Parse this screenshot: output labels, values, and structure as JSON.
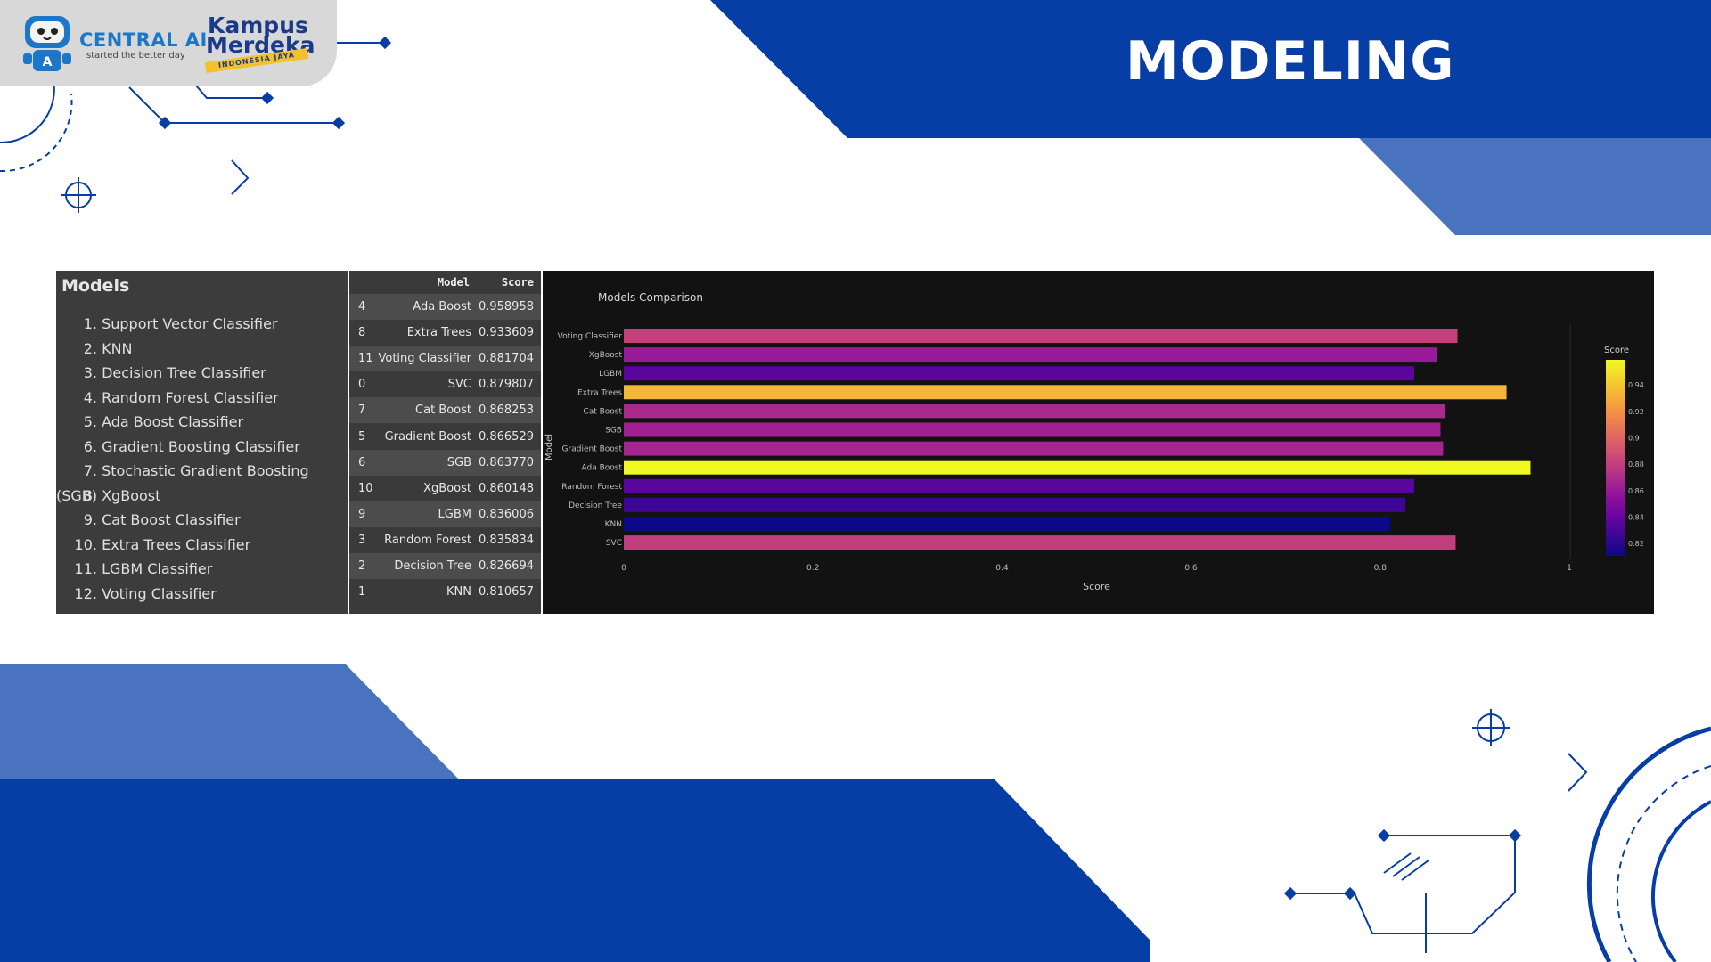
{
  "header": {
    "brand_name": "CENTRAL AI",
    "brand_tagline": "started the better day",
    "partner_line1": "Kampus",
    "partner_line2": "Merdeka",
    "partner_ribbon": "INDONESIA JAYA",
    "title": "MODELING"
  },
  "colors": {
    "primary_blue": "#073ea6",
    "light_blue": "#4a73bf",
    "panel_dark": "#121212"
  },
  "models_panel": {
    "title": "Models",
    "items": [
      {
        "num": "1.",
        "label": "Support Vector Classifier"
      },
      {
        "num": "2.",
        "label": "KNN"
      },
      {
        "num": "3.",
        "label": "Decision Tree Classifier"
      },
      {
        "num": "4.",
        "label": "Random Forest Classifier"
      },
      {
        "num": "5.",
        "label": "Ada Boost Classifier"
      },
      {
        "num": "6.",
        "label": "Gradient Boosting Classifier"
      },
      {
        "num": "7.",
        "label": "Stochastic Gradient Boosting (SGB)"
      },
      {
        "num": "8.",
        "label": "XgBoost"
      },
      {
        "num": "9.",
        "label": "Cat Boost Classifier"
      },
      {
        "num": "10.",
        "label": "Extra Trees Classifier"
      },
      {
        "num": "11.",
        "label": "LGBM Classifier"
      },
      {
        "num": "12.",
        "label": "Voting Classifier"
      }
    ]
  },
  "score_table": {
    "col_model": "Model",
    "col_score": "Score",
    "rows": [
      {
        "idx": "4",
        "model": "Ada Boost",
        "score": "0.958958"
      },
      {
        "idx": "8",
        "model": "Extra Trees",
        "score": "0.933609"
      },
      {
        "idx": "11",
        "model": "Voting Classifier",
        "score": "0.881704"
      },
      {
        "idx": "0",
        "model": "SVC",
        "score": "0.879807"
      },
      {
        "idx": "7",
        "model": "Cat Boost",
        "score": "0.868253"
      },
      {
        "idx": "5",
        "model": "Gradient Boost",
        "score": "0.866529"
      },
      {
        "idx": "6",
        "model": "SGB",
        "score": "0.863770"
      },
      {
        "idx": "10",
        "model": "XgBoost",
        "score": "0.860148"
      },
      {
        "idx": "9",
        "model": "LGBM",
        "score": "0.836006"
      },
      {
        "idx": "3",
        "model": "Random Forest",
        "score": "0.835834"
      },
      {
        "idx": "2",
        "model": "Decision Tree",
        "score": "0.826694"
      },
      {
        "idx": "1",
        "model": "KNN",
        "score": "0.810657"
      }
    ]
  },
  "chart_data": {
    "type": "bar",
    "orientation": "horizontal",
    "title": "Models Comparison",
    "xlabel": "Score",
    "ylabel": "Model",
    "categories": [
      "Voting Classifier",
      "XgBoost",
      "LGBM",
      "Extra Trees",
      "Cat Boost",
      "SGB",
      "Gradient Boost",
      "Ada Boost",
      "Random Forest",
      "Decision Tree",
      "KNN",
      "SVC"
    ],
    "values": [
      0.881704,
      0.860148,
      0.836006,
      0.933609,
      0.868253,
      0.86377,
      0.866529,
      0.958958,
      0.835834,
      0.826694,
      0.810657,
      0.879807
    ],
    "xlim": [
      0,
      1
    ],
    "xticks": [
      "0",
      "0.2",
      "0.4",
      "0.6",
      "0.8",
      "1"
    ],
    "colorscale": "plasma",
    "colorbar": {
      "title": "Score",
      "range": [
        0.810657,
        0.958958
      ],
      "ticks": [
        "0.94",
        "0.92",
        "0.9",
        "0.88",
        "0.86",
        "0.84",
        "0.82"
      ]
    },
    "background": "#121212",
    "grid": false
  }
}
